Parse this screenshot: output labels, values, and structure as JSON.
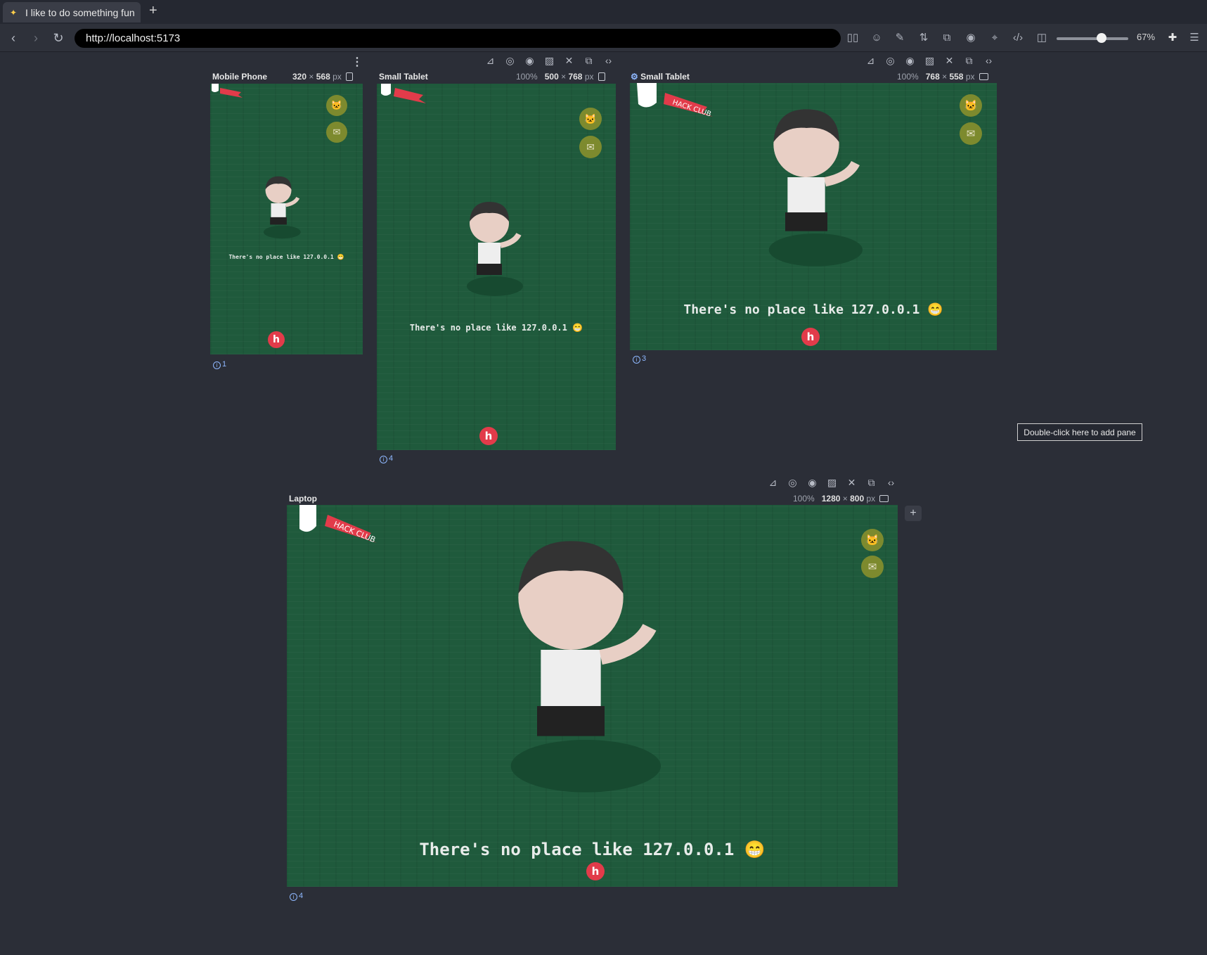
{
  "browser": {
    "tab_title": "I like to do something fun",
    "new_tab_label": "+",
    "url": "http://localhost:5173",
    "zoom": "67%"
  },
  "panes": [
    {
      "label": "Mobile Phone",
      "zoom": "",
      "width": "320",
      "height": "568",
      "unit": "px",
      "console_count": "1"
    },
    {
      "label": "Small Tablet",
      "zoom": "100%",
      "width": "500",
      "height": "768",
      "unit": "px",
      "console_count": "4"
    },
    {
      "label": "Small Tablet",
      "zoom": "100%",
      "width": "768",
      "height": "558",
      "unit": "px",
      "console_count": "3"
    },
    {
      "label": "Laptop",
      "zoom": "100%",
      "width": "1280",
      "height": "800",
      "unit": "px",
      "console_count": "4"
    }
  ],
  "site": {
    "banner_text": "HACK CLUB",
    "message": "There's no place like 127.0.0.1",
    "emoji": "😁",
    "h_button": "h",
    "github_icon": "github-icon",
    "mail_icon": "mail-icon"
  },
  "tooltip": "Double-click here to add pane",
  "add_pane_label": "+",
  "colors": {
    "page_bg": "#2b2e37",
    "site_bg": "#1f5a3c",
    "side_button": "#7d8a2e",
    "hack_red": "#e23b4a"
  }
}
